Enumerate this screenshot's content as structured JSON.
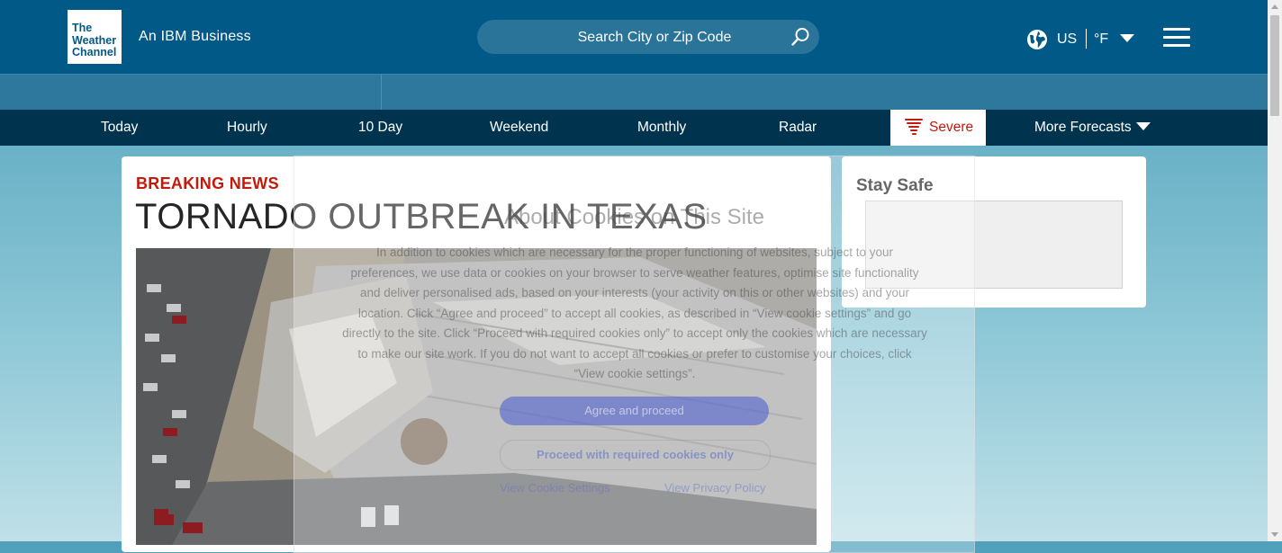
{
  "header": {
    "logo_lines": [
      "The",
      "Weather",
      "Channel"
    ],
    "tagline": "An IBM Business",
    "search_placeholder": "Search City or Zip Code",
    "search_icon": "search-icon",
    "locale_icon": "globe-icon",
    "locale_country": "US",
    "locale_unit": "°F",
    "menu_icon": "hamburger-menu-icon"
  },
  "nav": {
    "items": [
      "Today",
      "Hourly",
      "10 Day",
      "Weekend",
      "Monthly",
      "Radar"
    ],
    "severe": "Severe",
    "more": "More Forecasts"
  },
  "article": {
    "kicker": "BREAKING NEWS",
    "headline": "TORNADO OUTBREAK IN TEXAS"
  },
  "sidebar": {
    "title": "Stay Safe"
  },
  "cookie_dialog": {
    "title": "About Cookies on This Site",
    "body": "In addition to cookies which are necessary for the proper functioning of websites, subject to your preferences, we use data or cookies on your browser to serve weather features, optimise site functionality and deliver personalised ads, based on your interests (your activity on this or other websites) and your location. Click “Agree and proceed” to accept all cookies, as described in “View cookie settings” and go directly to the site. Click “Proceed with required cookies only” to accept only the cookies which are necessary to make our site work. If you do not want to accept all cookies or prefer to customise your choices, click “View cookie settings”.",
    "agree_button": "Agree and proceed",
    "required_button": "Proceed with required cookies only",
    "settings_link": "View Cookie Settings",
    "privacy_link": "View Privacy Policy"
  },
  "colors": {
    "header_bg": "#005986",
    "nav_bg": "#00344e",
    "alert_red": "#c41a0b"
  }
}
